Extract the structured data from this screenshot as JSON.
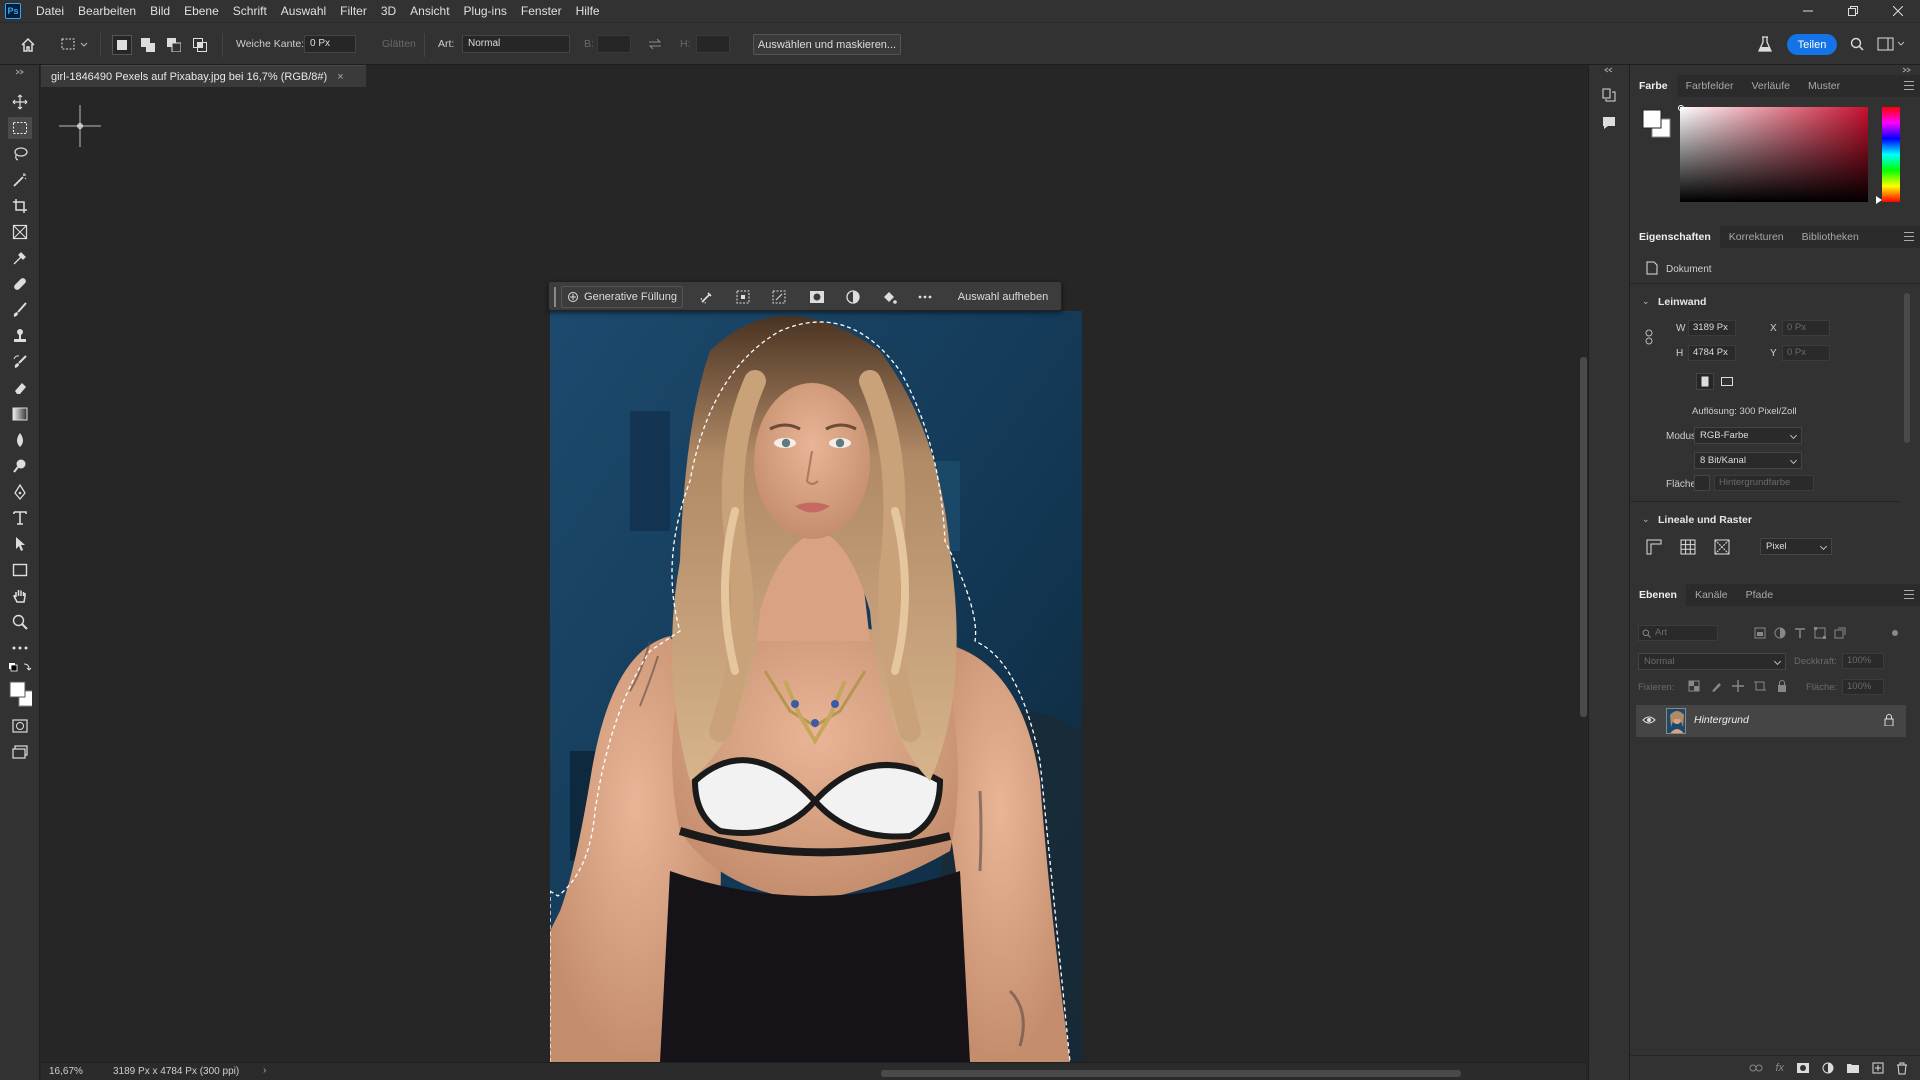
{
  "app": {
    "logo": "Ps"
  },
  "menu": [
    "Datei",
    "Bearbeiten",
    "Bild",
    "Ebene",
    "Schrift",
    "Auswahl",
    "Filter",
    "3D",
    "Ansicht",
    "Plug-ins",
    "Fenster",
    "Hilfe"
  ],
  "options": {
    "feather_label": "Weiche Kante:",
    "feather_value": "0 Px",
    "antialias_label": "Glätten",
    "style_label": "Art:",
    "style_value": "Normal",
    "width_label": "B:",
    "height_label": "H:",
    "select_mask": "Auswählen und maskieren...",
    "share": "Teilen"
  },
  "document": {
    "tab_title": "girl-1846490 Pexels auf Pixabay.jpg bei 16,7% (RGB/8#)",
    "close": "×"
  },
  "context_bar": {
    "generative_fill": "Generative Füllung",
    "deselect": "Auswahl aufheben"
  },
  "status": {
    "zoom": "16,67%",
    "doc_info": "3189 Px x 4784 Px (300 ppi)"
  },
  "color_panel": {
    "tabs": [
      "Farbe",
      "Farbfelder",
      "Verläufe",
      "Muster"
    ]
  },
  "properties_panel": {
    "tabs": [
      "Eigenschaften",
      "Korrekturen",
      "Bibliotheken"
    ],
    "doc_label": "Dokument",
    "canvas_heading": "Leinwand",
    "w_label": "W",
    "w_value": "3189 Px",
    "h_label": "H",
    "h_value": "4784 Px",
    "x_label": "X",
    "x_value": "0 Px",
    "y_label": "Y",
    "y_value": "0 Px",
    "resolution": "Auflösung: 300 Pixel/Zoll",
    "mode_label": "Modus",
    "mode_value": "RGB-Farbe",
    "depth_value": "8 Bit/Kanal",
    "fill_label": "Fläche",
    "fill_value": "Hintergrundfarbe",
    "rulers_heading": "Lineale und Raster",
    "unit_value": "Pixel"
  },
  "layers_panel": {
    "tabs": [
      "Ebenen",
      "Kanäle",
      "Pfade"
    ],
    "search_placeholder": "Art",
    "blend_mode": "Normal",
    "opacity_label": "Deckkraft:",
    "opacity_value": "100%",
    "lock_label": "Fixieren:",
    "fill_label": "Fläche:",
    "fill_value": "100%",
    "layer_name": "Hintergrund"
  },
  "colors": {
    "accent": "#1473e6",
    "panel": "#323232",
    "canvas": "#262626"
  }
}
